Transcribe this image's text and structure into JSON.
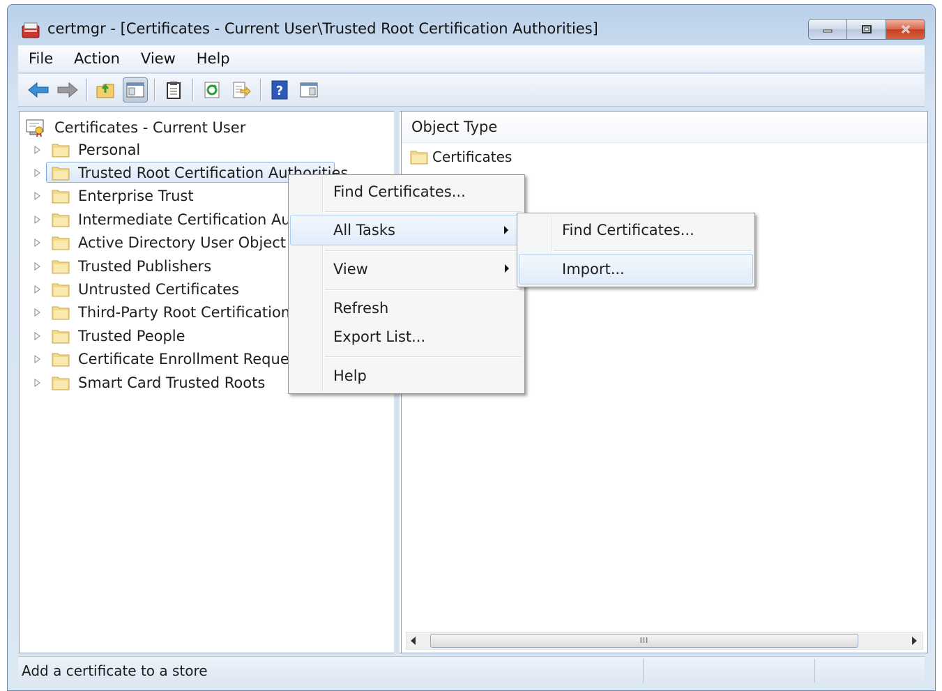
{
  "window": {
    "title": "certmgr - [Certificates - Current User\\Trusted Root Certification Authorities]"
  },
  "menubar": {
    "items": [
      "File",
      "Action",
      "View",
      "Help"
    ]
  },
  "toolbar": {
    "buttons": [
      "back-icon",
      "forward-icon",
      "up-folder-icon",
      "show-hide-tree-icon",
      "clipboard-icon",
      "refresh-icon",
      "export-list-icon",
      "help-icon",
      "properties-pane-icon"
    ]
  },
  "tree": {
    "root": "Certificates - Current User",
    "items": [
      "Personal",
      "Trusted Root Certification Authorities",
      "Enterprise Trust",
      "Intermediate Certification Auth",
      "Active Directory User Object",
      "Trusted Publishers",
      "Untrusted Certificates",
      "Third-Party Root Certification A",
      "Trusted People",
      "Certificate Enrollment Requests",
      "Smart Card Trusted Roots"
    ],
    "selected_index": 1
  },
  "list": {
    "column_header": "Object Type",
    "rows": [
      "Certificates"
    ],
    "scroll_thumb_grip": "III"
  },
  "context_menu": {
    "items": [
      "Find Certificates...",
      "All Tasks",
      "View",
      "Refresh",
      "Export List...",
      "Help"
    ],
    "hovered": "All Tasks"
  },
  "submenu": {
    "items": [
      "Find Certificates...",
      "Import..."
    ],
    "hovered": "Import..."
  },
  "status": {
    "text": "Add a certificate to a store"
  },
  "colors": {
    "titlebar": "#c9daee",
    "selection_border": "#84acdd",
    "close_button": "#c4401f"
  }
}
